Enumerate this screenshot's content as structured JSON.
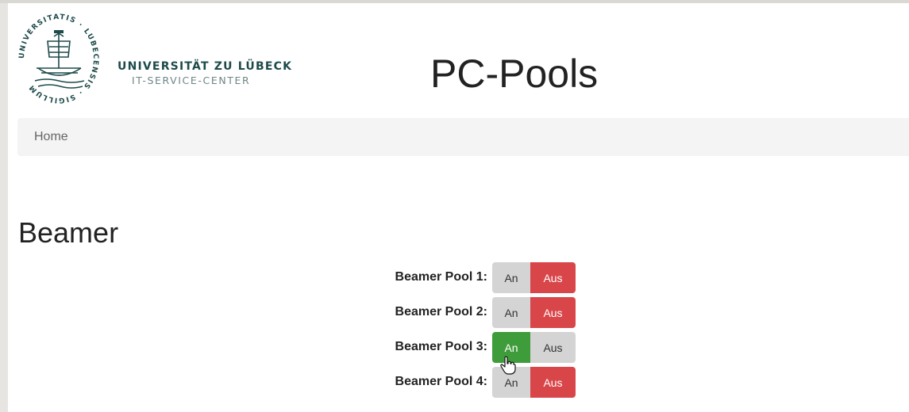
{
  "header": {
    "logo_seal_text": "UNIVERSITATIS · LUBECENSIS · SIGILLUM",
    "university_name": "UNIVERSITÄT ZU LÜBECK",
    "department": "IT-SERVICE-CENTER",
    "page_title": "PC-Pools"
  },
  "breadcrumb": {
    "home_label": "Home"
  },
  "section": {
    "title": "Beamer"
  },
  "beamers": [
    {
      "label": "Beamer Pool 1:",
      "on_label": "An",
      "off_label": "Aus",
      "state": "off"
    },
    {
      "label": "Beamer Pool 2:",
      "on_label": "An",
      "off_label": "Aus",
      "state": "off"
    },
    {
      "label": "Beamer Pool 3:",
      "on_label": "An",
      "off_label": "Aus",
      "state": "on"
    },
    {
      "label": "Beamer Pool 4:",
      "on_label": "An",
      "off_label": "Aus",
      "state": "off"
    }
  ],
  "colors": {
    "on_active": "#3e9c3a",
    "off_active": "#d9464a",
    "inactive": "#d4d4d4",
    "brand": "#1e4a4a"
  },
  "icons": {
    "logo": "university-seal-icon",
    "cursor": "hand-pointer-icon"
  }
}
